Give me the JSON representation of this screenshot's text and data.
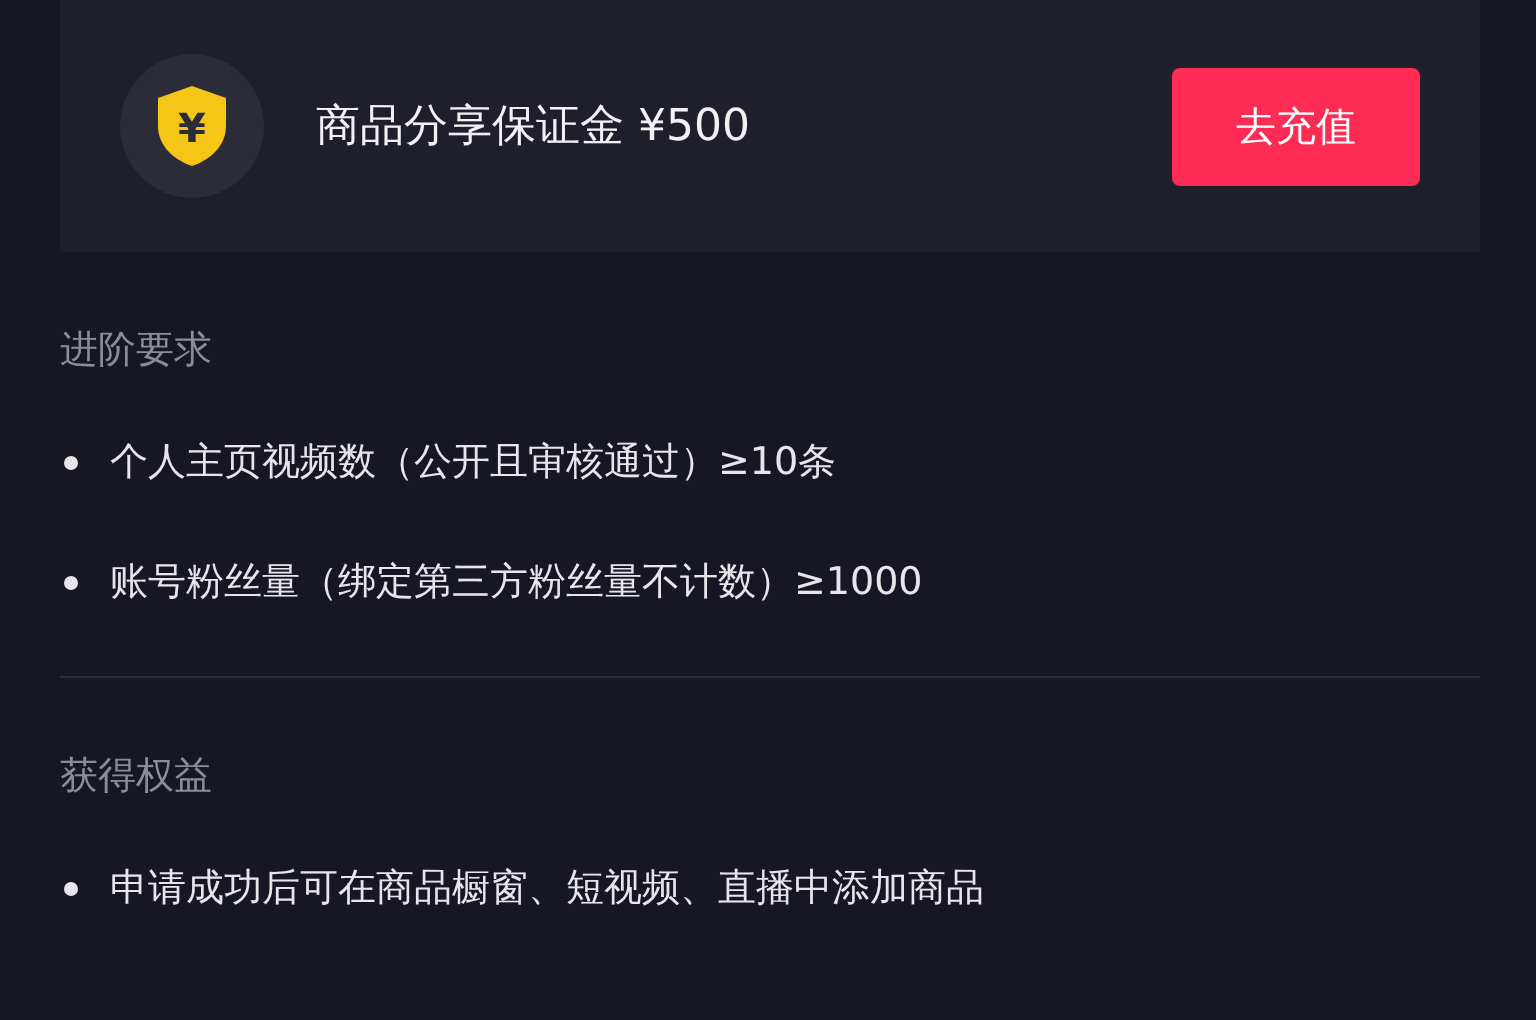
{
  "deposit_card": {
    "icon_text": "¥",
    "label": "商品分享保证金 ¥500",
    "button": "去充值"
  },
  "sections": [
    {
      "title": "进阶要求",
      "items": [
        "个人主页视频数（公开且审核通过）≥10条",
        "账号粉丝量（绑定第三方粉丝量不计数）≥1000"
      ]
    },
    {
      "title": "获得权益",
      "items": [
        "申请成功后可在商品橱窗、短视频、直播中添加商品"
      ]
    }
  ]
}
